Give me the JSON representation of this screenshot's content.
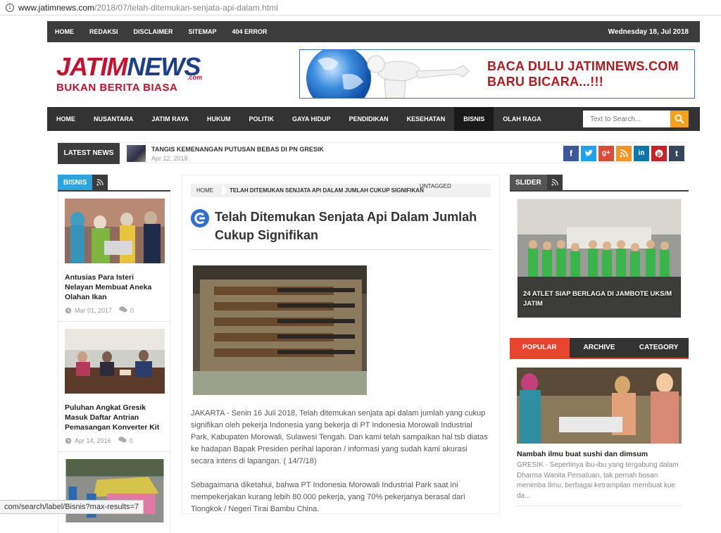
{
  "browser": {
    "url_domain": "www.jatimnews.com",
    "url_path": "/2018/07/telah-ditemukan-senjata-api-dalam.html",
    "status_url": "com/search/label/Bisnis?max-results=7"
  },
  "topnav": {
    "items": [
      "HOME",
      "REDAKSI",
      "DISCLAIMER",
      "SITEMAP",
      "404 ERROR"
    ],
    "date": "Wednesday 18, Jul 2018"
  },
  "logo": {
    "jatim": "JATIM",
    "news": "NEWS",
    "com": ".com",
    "tagline": "BUKAN BERITA BIASA"
  },
  "banner": {
    "line1": "BACA DULU JATIMNEWS.COM",
    "line2": "BARU BICARA...!!!"
  },
  "mainnav": {
    "items": [
      "HOME",
      "NUSANTARA",
      "JATIM RAYA",
      "HUKUM",
      "POLITIK",
      "GAYA HIDUP",
      "PENDIDIKAN",
      "KESEHATAN",
      "BISNIS",
      "OLAH RAGA"
    ],
    "active": "BISNIS",
    "search_placeholder": "Text to Search..."
  },
  "latest": {
    "label": "LATEST NEWS",
    "title": "TANGIS KEMENANGAN PUTUSAN BEBAS DI PN GRESIK",
    "date": "Apr 12, 2018"
  },
  "social": {
    "icons": [
      "facebook-icon",
      "twitter-icon",
      "google-plus-icon",
      "rss-icon",
      "linkedin-icon",
      "pinterest-icon",
      "tumblr-icon"
    ],
    "colors": [
      "#3b5998",
      "#1da1f2",
      "#dd4b39",
      "#f7931e",
      "#0e76a8",
      "#cb2027",
      "#35465c"
    ]
  },
  "left": {
    "section": "BISNIS",
    "posts": [
      {
        "title": "Antusias Para Isteri Nelayan Membuat Aneka Olahan Ikan",
        "date": "Mar 01, 2017",
        "comments": "0"
      },
      {
        "title": "Puluhan Angkat Gresik Masuk Daftar Antrian Pemasangan Konverter Kit",
        "date": "Apr 14, 2016",
        "comments": "0"
      }
    ]
  },
  "article": {
    "crumb_home": "HOME",
    "crumb_title": "TELAH DITEMUKAN SENJATA API DALAM JUMLAH CUKUP SIGNIFIKAN",
    "crumb_tag": "UNTAGGED",
    "title": "Telah Ditemukan Senjata Api Dalam Jumlah Cukup Signifikan",
    "p1": "JAKARTA - Senin 16 Juli 2018, Telah ditemukan senjata api dalam jumlah yang cukup signifikan oleh pekerja Indonesia yang bekerja di PT Indonesia Morowali Industrial Park, Kabupaten Morowali, Sulawesi Tengah. Dan kami telah sampaikan hal tsb diatas ke hadapan Bapak Presiden perihal laporan / informasi yang sudah kami akurasi secara intens di lapangan. ( 14/7/18)",
    "p2": "Sebagaimana diketahui, bahwa PT Indonesia Morowali Industrial Park saat ini mempekerjakan kurang lebih 80.000 pekerja,  yang 70% pekerjanya berasal dari Tiongkok / Negeri Tirai Bambu China."
  },
  "right": {
    "section": "SLIDER",
    "slider_caption": "24 ATLET SIAP BERLAGA DI JAMBOTE UKS/M JATIM",
    "tabs": [
      "POPULAR",
      "ARCHIVE",
      "CATEGORY"
    ],
    "popular_title": "Nambah ilmu buat sushi dan dimsum",
    "popular_excerpt": "GRESIK - Sepertinya ibu-ibu yang tergabung dalam Dharma Wanita Persatuan, tak pernah bosan menimba Ilmu, berbagai ketrampilan membuat kue da..."
  }
}
